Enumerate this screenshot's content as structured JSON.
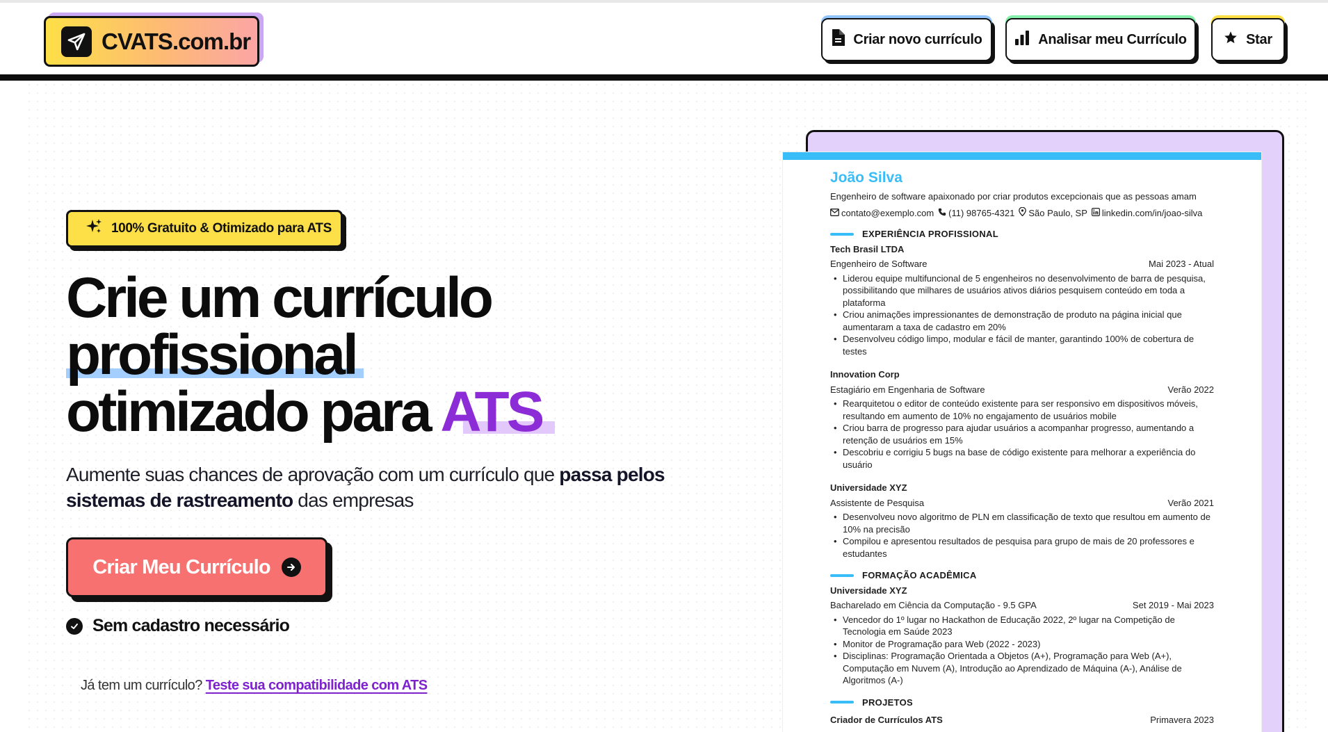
{
  "header": {
    "logo_text": "CVATS.com.br",
    "nav": [
      {
        "label": "Criar novo currículo",
        "icon": "file-document-icon",
        "accent": "#93c5fd"
      },
      {
        "label": "Analisar meu Currículo",
        "icon": "bar-chart-icon",
        "accent": "#86efac"
      },
      {
        "label": "Star",
        "icon": "star-icon",
        "accent": "#fde047"
      }
    ]
  },
  "hero": {
    "badge": "100% Gratuito & Otimizado para ATS",
    "headline_line1": "Crie um currículo",
    "headline_line2": "profissional",
    "headline_line3_prefix": "otimizado para ",
    "headline_line3_accent": "ATS",
    "sub_part1": "Aumente suas chances de aprovação com um currículo que ",
    "sub_bold": "passa pelos sistemas de rastreamento",
    "sub_part2": " das empresas",
    "cta_label": "Criar Meu Currículo",
    "no_signup": "Sem cadastro necessário",
    "already_text": "Já tem um currículo? ",
    "already_link": "Teste sua compatibilidade com ATS"
  },
  "resume": {
    "name": "João Silva",
    "summary": "Engenheiro de software apaixonado por criar produtos excepcionais que as pessoas amam",
    "email": "contato@exemplo.com",
    "phone": "(11) 98765-4321",
    "location": "São Paulo, SP",
    "linkedin": "linkedin.com/in/joao-silva",
    "sections": {
      "experience": "EXPERIÊNCIA PROFISSIONAL",
      "education": "FORMAÇÃO ACADÊMICA",
      "projects": "PROJETOS"
    },
    "experience": [
      {
        "company": "Tech Brasil LTDA",
        "role": "Engenheiro de Software",
        "date": "Mai 2023 - Atual",
        "bullets": [
          "Liderou equipe multifuncional de 5 engenheiros no desenvolvimento de barra de pesquisa, possibilitando que milhares de usuários ativos diários pesquisem conteúdo em toda a plataforma",
          "Criou animações impressionantes de demonstração de produto na página inicial que aumentaram a taxa de cadastro em 20%",
          "Desenvolveu código limpo, modular e fácil de manter, garantindo 100% de cobertura de testes"
        ]
      },
      {
        "company": "Innovation Corp",
        "role": "Estagiário em Engenharia de Software",
        "date": "Verão 2022",
        "bullets": [
          "Rearquitetou o editor de conteúdo existente para ser responsivo em dispositivos móveis, resultando em aumento de 10% no engajamento de usuários mobile",
          "Criou barra de progresso para ajudar usuários a acompanhar progresso, aumentando a retenção de usuários em 15%",
          "Descobriu e corrigiu 5 bugs na base de código existente para melhorar a experiência do usuário"
        ]
      },
      {
        "company": "Universidade XYZ",
        "role": "Assistente de Pesquisa",
        "date": "Verão 2021",
        "bullets": [
          "Desenvolveu novo algoritmo de PLN em classificação de texto que resultou em aumento de 10% na precisão",
          "Compilou e apresentou resultados de pesquisa para grupo de mais de 20 professores e estudantes"
        ]
      }
    ],
    "education": {
      "school": "Universidade XYZ",
      "degree": "Bacharelado em Ciência da Computação - 9.5 GPA",
      "date": "Set 2019 - Mai 2023",
      "bullets": [
        "Vencedor do 1º lugar no Hackathon de Educação 2022, 2º lugar na Competição de Tecnologia em Saúde 2023",
        "Monitor de Programação para Web (2022 - 2023)",
        "Disciplinas: Programação Orientada a Objetos (A+), Programação para Web (A+), Computação em Nuvem (A), Introdução ao Aprendizado de Máquina (A-), Análise de Algoritmos (A-)"
      ]
    },
    "project": {
      "name": "Criador de Currículos ATS",
      "date": "Primavera 2023"
    }
  }
}
